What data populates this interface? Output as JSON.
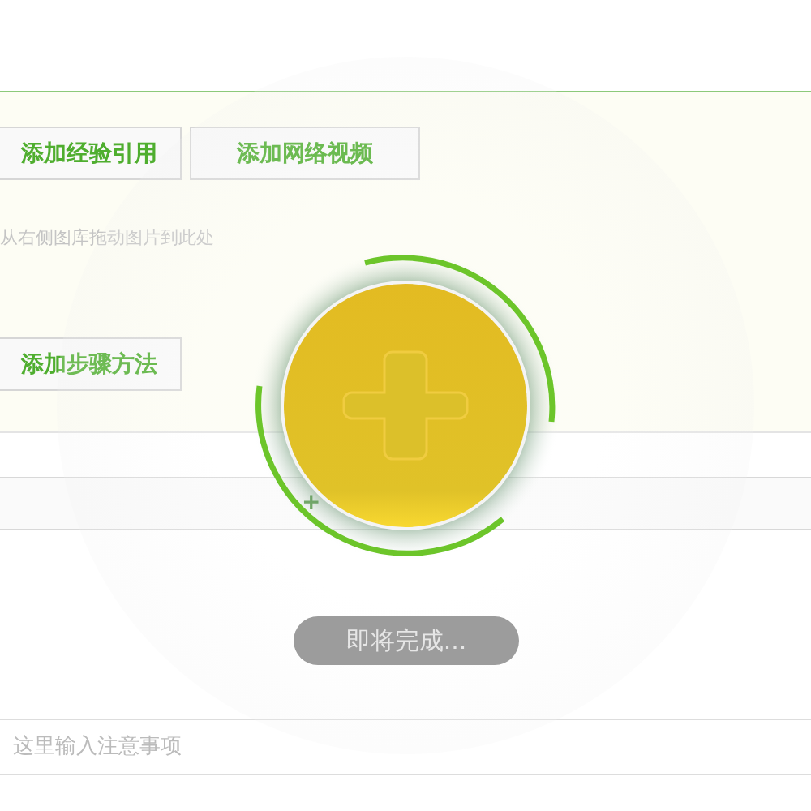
{
  "editor": {
    "top_buttons": [
      {
        "label": "添加经验引用"
      },
      {
        "label": "添加网络视频"
      }
    ],
    "image_hint": "从右侧图库拖动图片到此处",
    "step_button": {
      "label": "添加步骤方法"
    },
    "add_row": {
      "left": "+"
    },
    "notes": {
      "placeholder": "这里输入注意事项"
    }
  },
  "progress": {
    "status": "即将完成..."
  }
}
